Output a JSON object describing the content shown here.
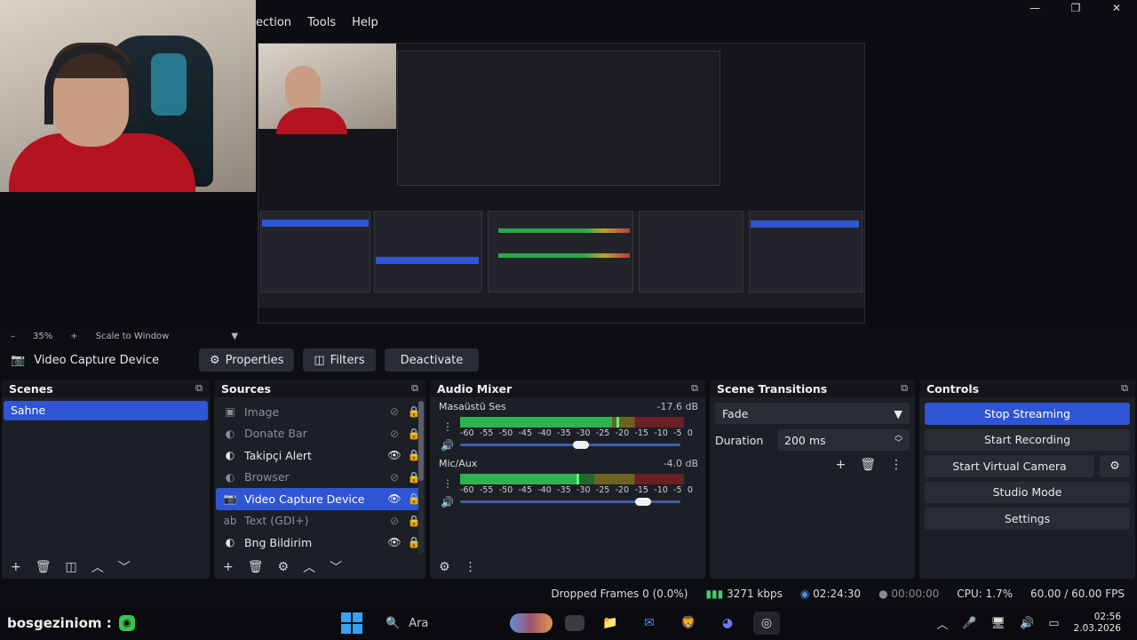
{
  "menubar": {
    "items": [
      "ection",
      "Tools",
      "Help"
    ]
  },
  "window_controls": {
    "minimize": "—",
    "maximize": "❐",
    "close": "✕"
  },
  "zoom": {
    "level": "35%",
    "plus": "+",
    "scale_mode": "Scale to Window"
  },
  "toolbar": {
    "source_name": "Video Capture Device",
    "properties_label": "Properties",
    "filters_label": "Filters",
    "deactivate_label": "Deactivate"
  },
  "scenes": {
    "title": "Scenes",
    "items": [
      "Sahne"
    ]
  },
  "sources": {
    "title": "Sources",
    "items": [
      {
        "name": "Image",
        "icon": "image-icon"
      },
      {
        "name": "Donate Bar",
        "icon": "globe-icon"
      },
      {
        "name": "Takipçi Alert",
        "icon": "globe-icon"
      },
      {
        "name": "Browser",
        "icon": "globe-icon"
      },
      {
        "name": "Video Capture Device",
        "icon": "camera-icon"
      },
      {
        "name": "Text (GDI+)",
        "icon": "text-icon"
      },
      {
        "name": "Bng Bildirim",
        "icon": "globe-icon"
      }
    ]
  },
  "mixer": {
    "title": "Audio Mixer",
    "channels": [
      {
        "name": "Masaüstü Ses",
        "db": "-17.6 dB",
        "level": 0.68,
        "peak": 0.7,
        "volume": 0.55
      },
      {
        "name": "Mic/Aux",
        "db": "-4.0 dB",
        "level": 0.52,
        "peak": 0.52,
        "volume": 0.83
      }
    ],
    "ticks": [
      "-60",
      "-55",
      "-50",
      "-45",
      "-40",
      "-35",
      "-30",
      "-25",
      "-20",
      "-15",
      "-10",
      "-5",
      "0"
    ]
  },
  "transitions": {
    "title": "Scene Transitions",
    "selected": "Fade",
    "duration_label": "Duration",
    "duration_value": "200 ms"
  },
  "controls": {
    "title": "Controls",
    "stop_streaming": "Stop Streaming",
    "start_recording": "Start Recording",
    "start_virtual_camera": "Start Virtual Camera",
    "studio_mode": "Studio Mode",
    "settings": "Settings"
  },
  "status": {
    "dropped_frames": "Dropped Frames 0 (0.0%)",
    "bitrate": "3271 kbps",
    "stream_time": "02:24:30",
    "rec_time": "00:00:00",
    "cpu": "CPU: 1.7%",
    "fps": "60.00 / 60.00 FPS"
  },
  "taskbar": {
    "username": "bosgeziniom :",
    "search_placeholder": "Ara",
    "time": "02:56",
    "date": "2.03.2026"
  }
}
